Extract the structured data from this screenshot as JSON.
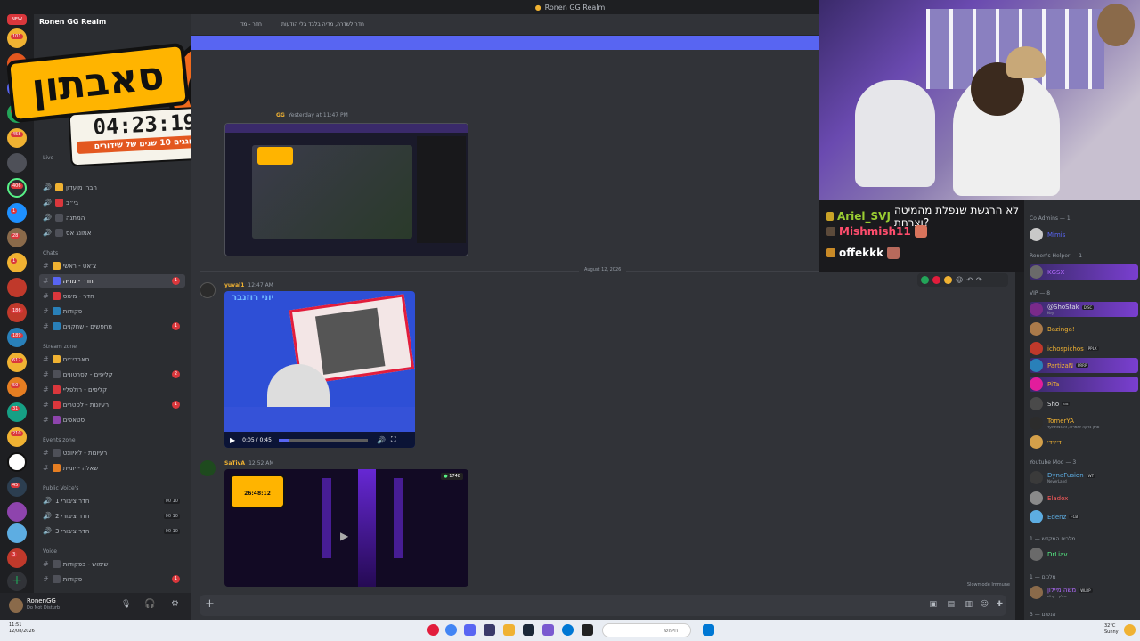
{
  "window": {
    "title": "Ronen GG Realm"
  },
  "header": {
    "server_name": "Ronen GG Realm",
    "channel": "חדר - מד",
    "topic": "חדר לשדרה, מדיה בלבד בלי הודעות"
  },
  "overlay": {
    "logo_word": "סאבתון",
    "timer": "04:23:19",
    "subtitle": "חוגגים 10 שנים של שידורים"
  },
  "channels": {
    "live_label": "Live",
    "categories": [
      "Chats",
      "Stream zone",
      "Events zone",
      "Public Voice's",
      "Voice"
    ],
    "items": [
      {
        "label": "חברי מועדון",
        "icon": "speaker-icon"
      },
      {
        "label": "בי״ב",
        "icon": "speaker-icon"
      },
      {
        "label": "המתנה",
        "icon": "speaker-icon"
      },
      {
        "label": "אמונג אס",
        "icon": "speaker-icon"
      },
      {
        "label": "צ'אט - ראשי",
        "icon": "hash-icon"
      },
      {
        "label": "חדר - מדיה",
        "icon": "hash-icon",
        "badge": "1"
      },
      {
        "label": "חדר - מימס",
        "icon": "hash-icon"
      },
      {
        "label": "פקודות",
        "icon": "hash-icon"
      },
      {
        "label": "מחפשים - שחקנים",
        "icon": "hash-icon",
        "badge": "1"
      },
      {
        "label": "סאבבי״ים",
        "icon": "hash-icon"
      },
      {
        "label": "קליפים - לסרטונים",
        "icon": "hash-icon",
        "badge": "2"
      },
      {
        "label": "קליפים - רולפליי",
        "icon": "hash-icon"
      },
      {
        "label": "רעיונות - לסטרים",
        "icon": "hash-icon",
        "badge": "1"
      },
      {
        "label": "סטאפים",
        "icon": "hash-icon"
      },
      {
        "label": "רעיונות - לאיוונט",
        "icon": "hash-icon"
      },
      {
        "label": "שאלה - יומית",
        "icon": "hash-icon"
      },
      {
        "label": "חדר ציבורי 1",
        "icon": "speaker-icon",
        "count": "00 10"
      },
      {
        "label": "חדר ציבורי 2",
        "icon": "speaker-icon",
        "count": "00 10"
      },
      {
        "label": "חדר ציבורי 3",
        "icon": "speaker-icon",
        "count": "00 10"
      },
      {
        "label": "שימוש - בפקודות",
        "icon": "hash-icon"
      },
      {
        "label": "פקודות",
        "icon": "hash-icon",
        "badge": "1"
      }
    ]
  },
  "server_badges": [
    "NEW",
    "101",
    "436",
    "458",
    "406",
    "1",
    "28",
    "1",
    "186",
    "189",
    "612",
    "50",
    "31",
    "210",
    "45",
    "3"
  ],
  "user": {
    "name": "RonenGG",
    "status": "Do Not Disturb"
  },
  "messages": [
    {
      "author": "GG",
      "time": "Yesterday at 11:47 PM"
    },
    {
      "divider": "August 12, 2026"
    },
    {
      "author": "yuval1",
      "time": "12:47 AM",
      "video_time": "0:05 / 0:45",
      "caption": "יוני רוזנבר"
    },
    {
      "author": "SaTivA",
      "time": "12:52 AM",
      "stream_timer": "26:48:12",
      "viewer_count": "1748"
    }
  ],
  "composer": {
    "slowmode": "Slowmode Immune"
  },
  "stream_chat": [
    {
      "user": "Ariel_SVJ",
      "text": "לא הרגשת שנפלת מהמיטה וצרחת?",
      "color": "#9acd32"
    },
    {
      "user": "Mishmish11",
      "text": "",
      "color": "#ff4d6d"
    },
    {
      "user": "offekkk",
      "text": "",
      "color": "#ffffff"
    }
  ],
  "members": {
    "co_admins": {
      "label": "Co Admins — 1",
      "items": [
        {
          "name": "Mimis",
          "color": "#5865f2"
        }
      ]
    },
    "helpers": {
      "label": "Ronen's Helper — 1",
      "items": [
        {
          "name": "KGSX",
          "color": "#b36cff"
        }
      ]
    },
    "vip": {
      "label": "VIP — 8",
      "items": [
        {
          "name": "@ShoStak",
          "tag": "DISC",
          "sub": "Key",
          "color": "#ffffff"
        },
        {
          "name": "Bazinga!",
          "color": "#f0b232"
        },
        {
          "name": "ichospichos",
          "tag": "PPLX",
          "color": "#f0b232"
        },
        {
          "name": "PartizaN",
          "tag": "PRRP",
          "color": "#f0b232"
        },
        {
          "name": "PiTa",
          "color": "#f0b232"
        },
        {
          "name": "Sho",
          "tag": "נוט",
          "color": "#ffffff"
        },
        {
          "name": "TomerYA",
          "sub": "סרק ברקה יותמרזה, זה בצזת יוער",
          "color": "#f0b232"
        },
        {
          "name": "דייוידי",
          "color": "#f0b232"
        }
      ]
    },
    "youtube_mod": {
      "label": "Youtube Mod — 3",
      "items": [
        {
          "name": "DynaFusion",
          "tag": "WT",
          "sub": "NeverLand",
          "color": "#5dade2"
        },
        {
          "name": "Eladox",
          "color": "#ff5c5c"
        },
        {
          "name": "Edenz",
          "tag": "FCB",
          "color": "#5dade2"
        }
      ]
    },
    "cat4": {
      "label": "מלכים המקדש — 1",
      "items": [
        {
          "name": "DrLiav",
          "color": "#57f287"
        }
      ]
    },
    "cat5": {
      "label": "מלכים — 1",
      "items": [
        {
          "name": "משה מיילון",
          "tag": "WLRP",
          "sub": "איילון - קולם",
          "color": "#b36cff"
        }
      ]
    },
    "cat6": {
      "label": "אנשים — 3"
    }
  },
  "taskbar": {
    "time": "11:51",
    "date": "12/08/2026",
    "search_placeholder": "חיפוש",
    "temp": "32°C",
    "weather": "Sunny"
  }
}
